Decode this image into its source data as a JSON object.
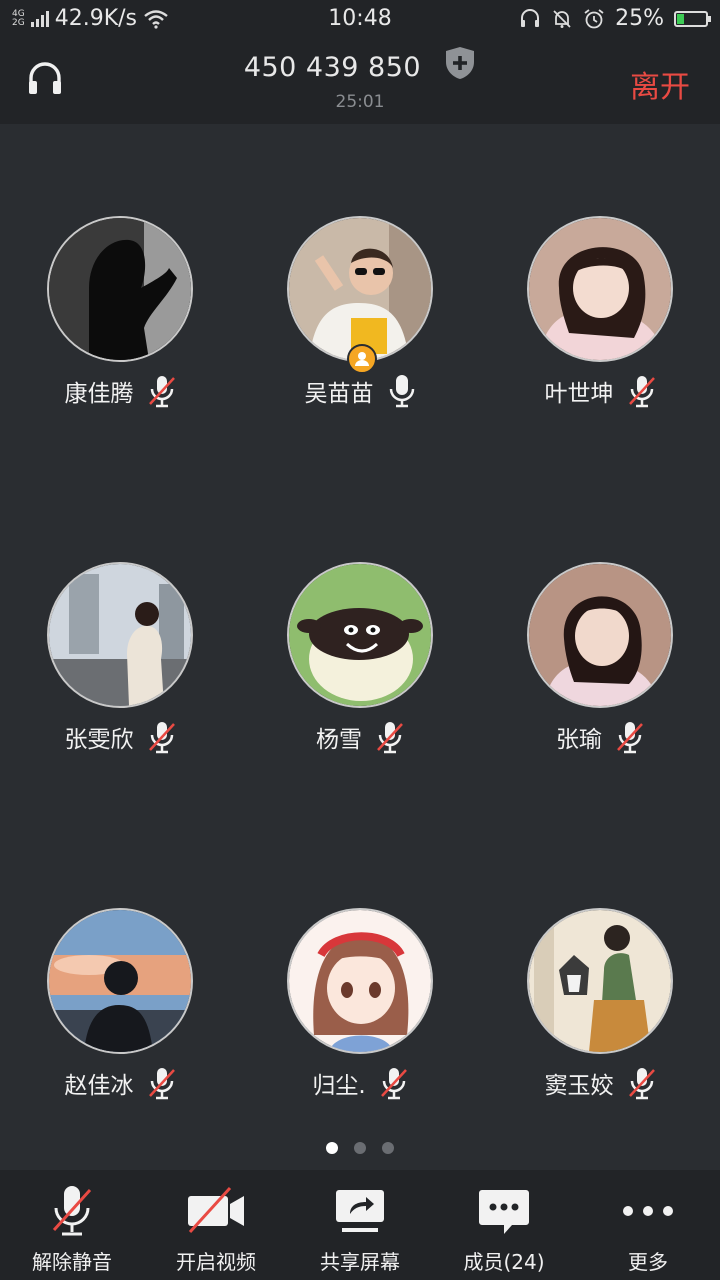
{
  "status_bar": {
    "net_type_top": "4G",
    "net_type_bottom": "2G",
    "speed": "42.9K/s",
    "time": "10:48",
    "battery": "25%",
    "battery_level": 0.25
  },
  "header": {
    "meeting_id": "450 439 850",
    "duration": "25:01",
    "leave_label": "离开"
  },
  "participants": [
    {
      "name": "康佳腾",
      "mic": "muted",
      "avatar": "dark-silhouette-photo",
      "host": false
    },
    {
      "name": "吴苗苗",
      "mic": "on",
      "avatar": "sunglasses-girl-photo",
      "host": true
    },
    {
      "name": "叶世坤",
      "mic": "muted",
      "avatar": "girl-pink-pajamas-photo",
      "host": false
    },
    {
      "name": "张雯欣",
      "mic": "muted",
      "avatar": "girl-street-photo",
      "host": false
    },
    {
      "name": "杨雪",
      "mic": "muted",
      "avatar": "cartoon-sheep",
      "host": false
    },
    {
      "name": "张瑜",
      "mic": "muted",
      "avatar": "girl-bangs-photo",
      "host": false
    },
    {
      "name": "赵佳冰",
      "mic": "muted",
      "avatar": "sunset-sky-photo",
      "host": false
    },
    {
      "name": "归尘.",
      "mic": "muted",
      "avatar": "anime-girl-red-headband",
      "host": false
    },
    {
      "name": "窦玉姣",
      "mic": "muted",
      "avatar": "illustration-husky-bag",
      "host": false
    }
  ],
  "pager": {
    "count": 3,
    "active": 0
  },
  "toolbar": {
    "unmute": "解除静音",
    "start_video": "开启视频",
    "share_screen": "共享屏幕",
    "members": "成员(24)",
    "more": "更多"
  },
  "colors": {
    "background": "#2a2d31",
    "bar": "#222427",
    "leave": "#e94a43",
    "mute_slash": "#e94a43",
    "host_badge": "#f5a623",
    "battery_fill": "#3dcb55"
  }
}
